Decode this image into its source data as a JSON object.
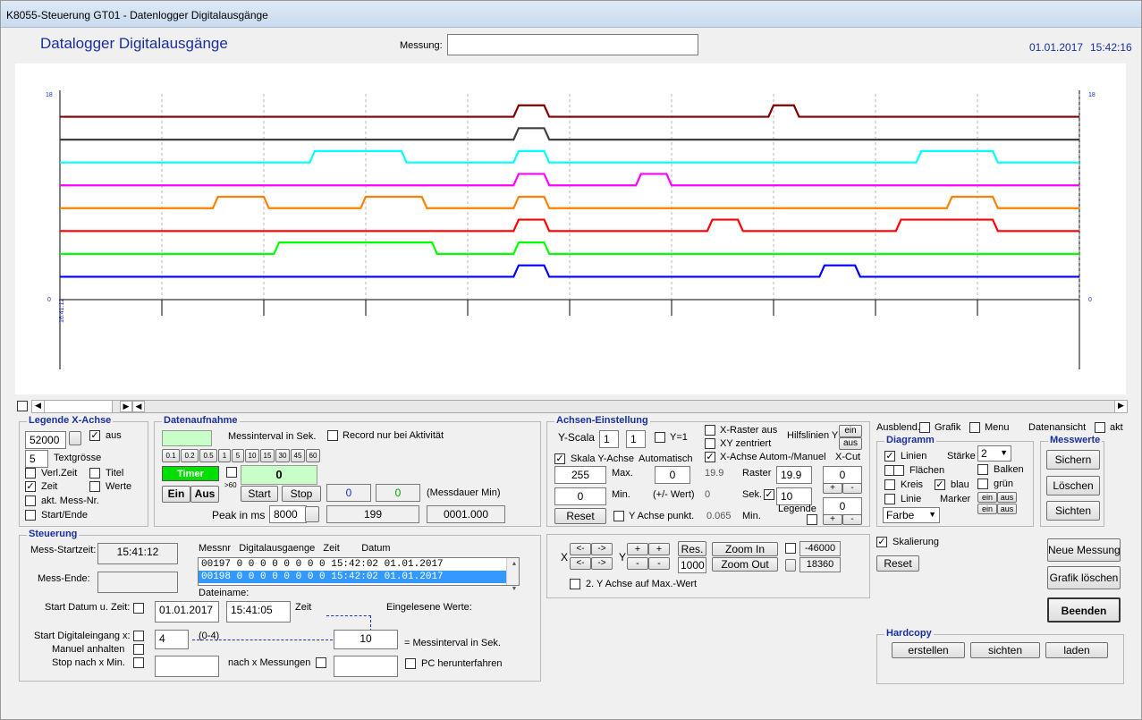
{
  "window": {
    "title": "K8055-Steuerung GT01 - Datenlogger Digitalausgänge"
  },
  "header": {
    "title": "Datalogger Digitalausgänge",
    "messung_label": "Messung:",
    "messung_value": "",
    "date": "01.01.2017",
    "time": "15:42:16"
  },
  "chart_data": {
    "type": "line",
    "ylim": [
      0,
      18
    ],
    "y_left_top": "18",
    "y_left_bottom": "0",
    "y_right_top": "18",
    "y_right_bottom": "0",
    "x_label": "16:41:12",
    "series": [
      {
        "color": "#800000",
        "base": 16,
        "pulses": [
          [
            0.445,
            0.48
          ],
          [
            0.695,
            0.725
          ]
        ]
      },
      {
        "color": "#404040",
        "base": 14,
        "pulses": [
          [
            0.445,
            0.48
          ]
        ]
      },
      {
        "color": "#00ffff",
        "base": 12,
        "pulses": [
          [
            0.245,
            0.34
          ],
          [
            0.445,
            0.48
          ],
          [
            0.84,
            0.92
          ]
        ]
      },
      {
        "color": "#ff00ff",
        "base": 10,
        "pulses": [
          [
            0.445,
            0.48
          ],
          [
            0.565,
            0.6
          ]
        ]
      },
      {
        "color": "#ff8000",
        "base": 8,
        "pulses": [
          [
            0.15,
            0.205
          ],
          [
            0.295,
            0.36
          ],
          [
            0.445,
            0.48
          ],
          [
            0.87,
            0.92
          ]
        ]
      },
      {
        "color": "#ff0000",
        "base": 6,
        "pulses": [
          [
            0.445,
            0.48
          ],
          [
            0.635,
            0.67
          ],
          [
            0.82,
            0.92
          ]
        ]
      },
      {
        "color": "#00ff00",
        "base": 4,
        "pulses": [
          [
            0.21,
            0.37
          ],
          [
            0.445,
            0.48
          ]
        ]
      },
      {
        "color": "#0000ff",
        "base": 2,
        "pulses": [
          [
            0.445,
            0.48
          ],
          [
            0.745,
            0.785
          ]
        ]
      }
    ]
  },
  "legende": {
    "title": "Legende X-Achse",
    "value": "52000",
    "aus": "aus",
    "textsize": "5",
    "textsize_label": "Textgrösse",
    "verl_zeit": "Verl.Zeit",
    "titel": "Titel",
    "zeit": "Zeit",
    "werte": "Werte",
    "mess_nr": "akt. Mess-Nr.",
    "start_ende": "Start/Ende"
  },
  "daten": {
    "title": "Datenaufnahme",
    "interval_label": "Messinterval in Sek.",
    "record": "Record nur bei Aktivität",
    "intervals": [
      "0.1",
      "0.2",
      "0.5",
      "1",
      "5",
      "10",
      "15",
      "30",
      "45",
      "60"
    ],
    "timer": "Timer",
    "ein": "Ein",
    "aus": "Aus",
    "gt60": ">60",
    "counter": "0",
    "start": "Start",
    "stop": "Stop",
    "v1": "0",
    "v2": "0",
    "messdauer": "(Messdauer Min)",
    "peak": "Peak in ms",
    "peak_value": "8000",
    "count": "199",
    "dauer": "0001.000"
  },
  "achsen": {
    "title": "Achsen-Einstellung",
    "yscala": "Y-Scala",
    "y1": "1",
    "y2": "1",
    "y1eq": "Y=1",
    "xraster": "X-Raster aus",
    "xy": "XY zentriert",
    "hilfslinien": "Hilfslinien Y",
    "ein": "ein",
    "aus": "aus",
    "skala_y": "Skala Y-Achse",
    "automatisch": "Automatisch",
    "x_achse": "X-Achse Autom-/Manuel",
    "xcut": "X-Cut",
    "max_val": "255",
    "max": "Max.",
    "max2": "0",
    "ro1": "19.9",
    "raster": "Raster",
    "raster_val": "19.9",
    "xcut_val": "0",
    "min_val": "0",
    "min": "Min.",
    "pm": "(+/- Wert)",
    "ro2": "0",
    "sek": "Sek.",
    "sek_val": "10",
    "legende": "Legende",
    "leg_val": "0",
    "reset": "Reset",
    "punkt": "Y Achse punkt.",
    "ro3": "0.065",
    "min2": "Min.",
    "plus": "+",
    "minus": "-"
  },
  "right": {
    "ausblend": "Ausblend.",
    "grafik": "Grafik",
    "menu": "Menu",
    "datenansicht": "Datenansicht",
    "akt": "akt",
    "diagramm": "Diagramm",
    "linien": "Linien",
    "staerke": "Stärke",
    "staerke_val": "2",
    "flaechen": "Flächen",
    "balken": "Balken",
    "kreis": "Kreis",
    "blau": "blau",
    "gruen": "grün",
    "linie": "Linie",
    "marker": "Marker",
    "ein": "ein",
    "aus": "aus",
    "farbe": "Farbe",
    "skalierung": "Skalierung",
    "reset": "Reset",
    "messwerte": "Messwerte",
    "sichern": "Sichern",
    "loeschen": "Löschen",
    "sichten": "Sichten",
    "neue": "Neue Messung",
    "grafik_loeschen": "Grafik löschen",
    "beenden": "Beenden",
    "hardcopy": "Hardcopy",
    "erstellen": "erstellen",
    "sichten2": "sichten",
    "laden": "laden"
  },
  "zoom": {
    "xl": "<-",
    "xr": "->",
    "x": "X",
    "y": "Y",
    "res": "Res.",
    "res_val": "1000",
    "zoom_in": "Zoom In",
    "zoom_out": "Zoom Out",
    "v1": "-46000",
    "v2": "18360",
    "y2": "2. Y Achse auf Max.-Wert",
    "plus": "+",
    "minus": "-"
  },
  "steuerung": {
    "title": "Steuerung",
    "start_label": "Mess-Startzeit:",
    "start_val": "15:41:12",
    "ende_label": "Mess-Ende:",
    "ende_val": "",
    "cols": "Messnr   Digitalausgaenge   Zeit        Datum",
    "rows": [
      "00197  0  0  0  0  0  0  0  0  15:42:02   01.01.2017",
      "00198  0  0  0  0  0  0  0  0  15:42:02   01.01.2017"
    ],
    "dateiname": "Dateiname:",
    "start_datum": "Start Datum u. Zeit:",
    "datum_val": "01.01.2017",
    "zeit_val": "15:41:05",
    "zeit": "Zeit",
    "eingelesen": "Eingelesene Werte:",
    "start_dig": "Start Digitaleingang x:",
    "dig_val": "4",
    "range": "(0-4)",
    "interval_val": "10",
    "interval_label": "= Messinterval in Sek.",
    "manuel": "Manuel anhalten",
    "stop_nach": "Stop nach x Min.",
    "nach_mess": "nach x Messungen",
    "pc": "PC herunterfahren"
  }
}
